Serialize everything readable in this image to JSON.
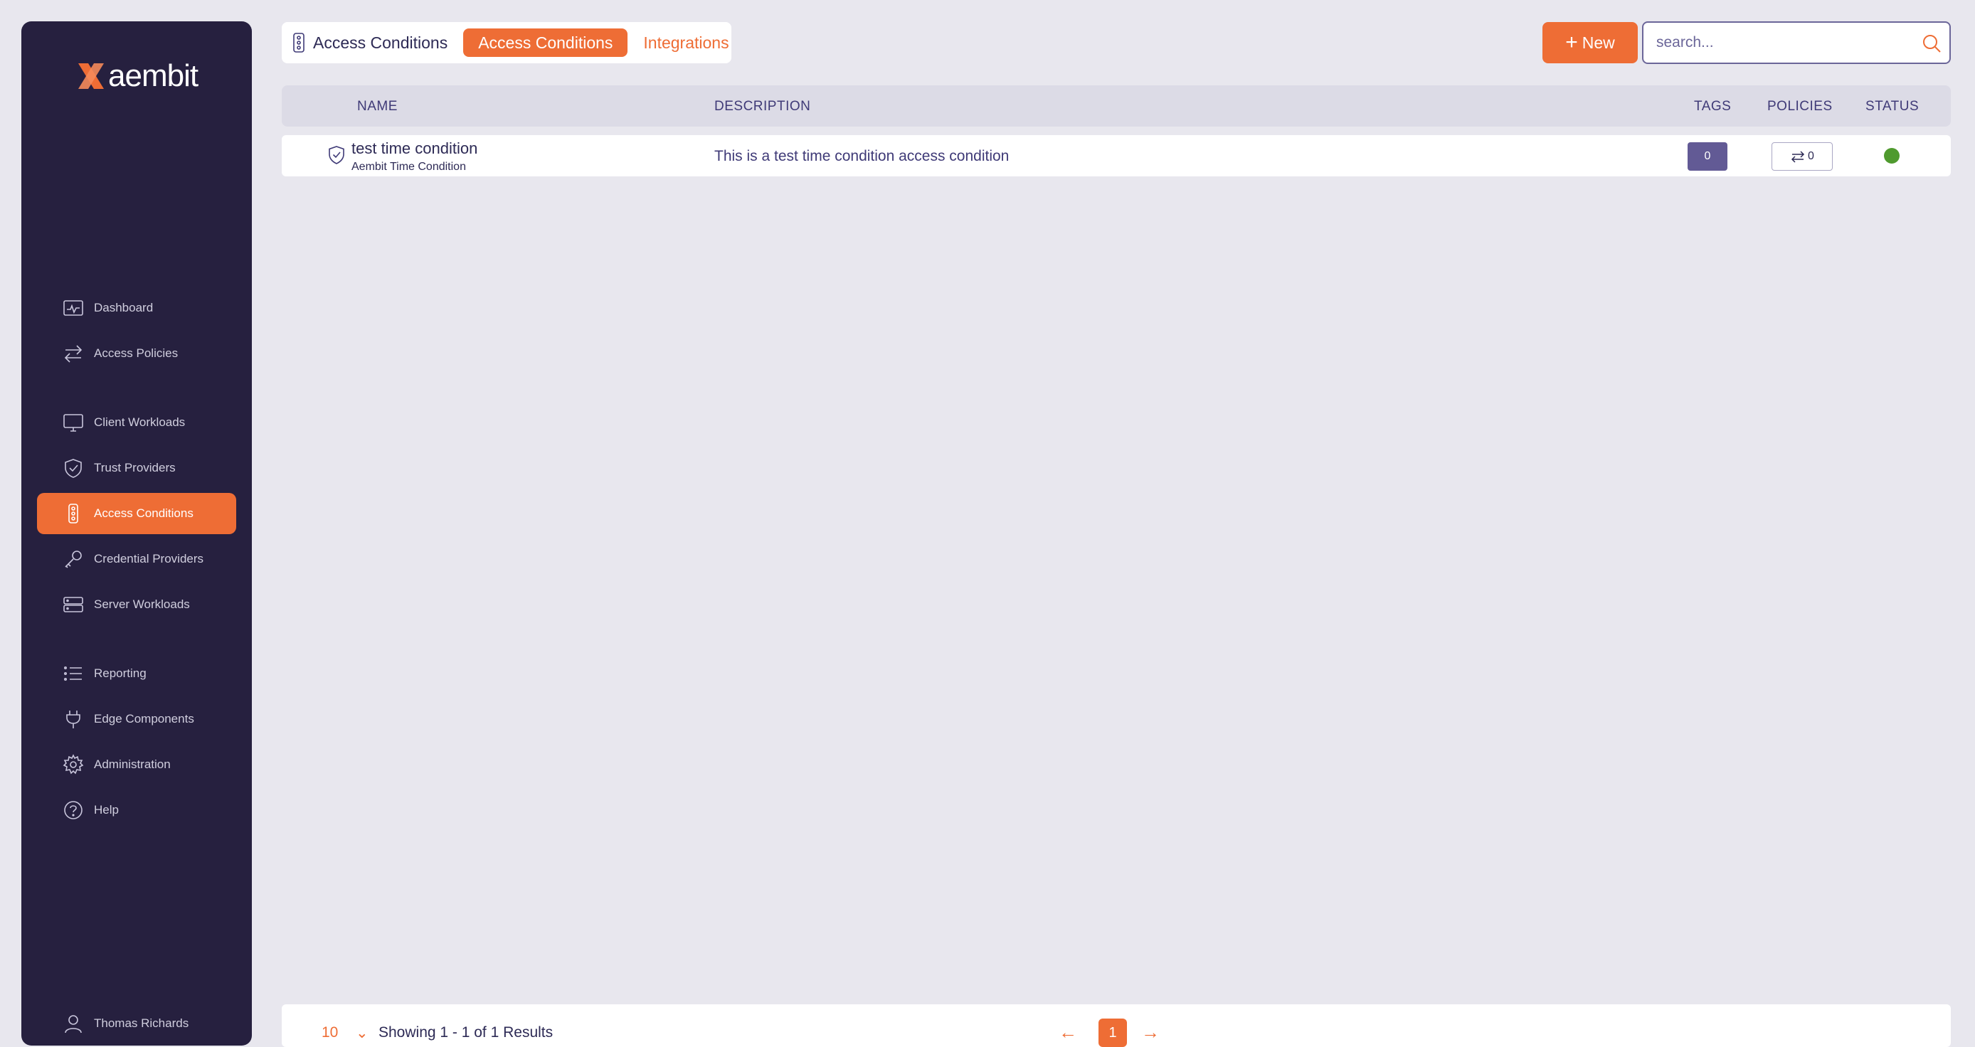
{
  "app": {
    "brand": "aembit"
  },
  "sidebar": {
    "items": [
      {
        "label": "Dashboard",
        "icon": "dashboard-icon"
      },
      {
        "label": "Access Policies",
        "icon": "arrows-exchange-icon"
      },
      {
        "label": "Client Workloads",
        "icon": "monitor-icon"
      },
      {
        "label": "Trust Providers",
        "icon": "shield-check-icon"
      },
      {
        "label": "Access Conditions",
        "icon": "traffic-light-icon",
        "active": true
      },
      {
        "label": "Credential Providers",
        "icon": "key-icon"
      },
      {
        "label": "Server Workloads",
        "icon": "server-icon"
      },
      {
        "label": "Reporting",
        "icon": "list-icon"
      },
      {
        "label": "Edge Components",
        "icon": "plug-icon"
      },
      {
        "label": "Administration",
        "icon": "gear-icon"
      },
      {
        "label": "Help",
        "icon": "help-circle-icon"
      }
    ],
    "user": {
      "name": "Thomas Richards",
      "icon": "user-icon"
    }
  },
  "topbar": {
    "title": "Access Conditions",
    "tabs": [
      {
        "label": "Access Conditions",
        "active": true
      },
      {
        "label": "Integrations",
        "active": false
      }
    ]
  },
  "toolbar": {
    "new_label": "New",
    "search_placeholder": "search..."
  },
  "table": {
    "columns": [
      "NAME",
      "DESCRIPTION",
      "TAGS",
      "POLICIES",
      "STATUS"
    ],
    "rows": [
      {
        "name": "test time condition",
        "type": "Aembit Time Condition",
        "description": "This is a test time condition access condition",
        "tags": "0",
        "policies": "0",
        "status": "active"
      }
    ]
  },
  "pagination": {
    "per_page": "10",
    "summary": "Showing 1 - 1 of 1 Results",
    "current_page": "1"
  },
  "colors": {
    "accent": "#ee6d35",
    "sidebar_bg": "#26203f",
    "page_bg": "#e8e7ee",
    "status_active": "#4f9a2e",
    "tag_badge": "#625a95"
  }
}
